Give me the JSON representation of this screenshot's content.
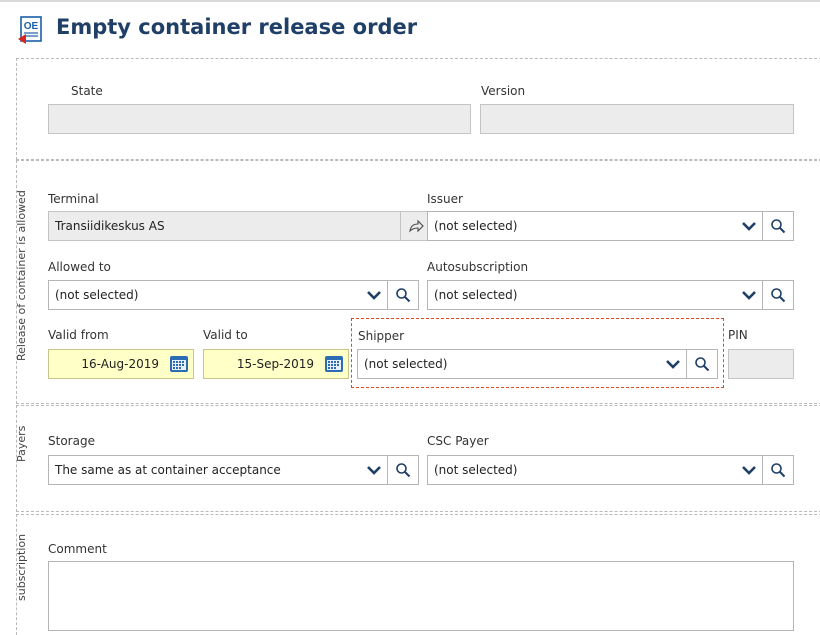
{
  "header": {
    "icon_label": "OE",
    "title": "Empty container release order"
  },
  "state_section": {
    "state_label": "State",
    "state_value": "",
    "version_label": "Version",
    "version_value": ""
  },
  "release_section": {
    "vertical_label": "Release of container is allowed",
    "terminal_label": "Terminal",
    "terminal_value": "Transiidikeskus AS",
    "issuer_label": "Issuer",
    "issuer_value": "(not selected)",
    "allowed_to_label": "Allowed to",
    "allowed_to_value": "(not selected)",
    "autosubscription_label": "Autosubscription",
    "autosubscription_value": "(not selected)",
    "valid_from_label": "Valid from",
    "valid_from_value": "16-Aug-2019",
    "valid_to_label": "Valid to",
    "valid_to_value": "15-Sep-2019",
    "shipper_label": "Shipper",
    "shipper_value": "(not selected)",
    "pin_label": "PIN",
    "pin_value": ""
  },
  "payers_section": {
    "vertical_label": "Payers",
    "storage_label": "Storage",
    "storage_value": "The same as at container acceptance",
    "csc_payer_label": "CSC Payer",
    "csc_payer_value": "(not selected)"
  },
  "subscription_section": {
    "vertical_label": "subscription",
    "comment_label": "Comment",
    "comment_value": ""
  },
  "colors": {
    "title": "#1f3f66",
    "date_bg": "#ffffc8",
    "readonly_bg": "#ececec",
    "highlight_border": "#e04a1a",
    "icon_accent": "#1a5fa8"
  }
}
